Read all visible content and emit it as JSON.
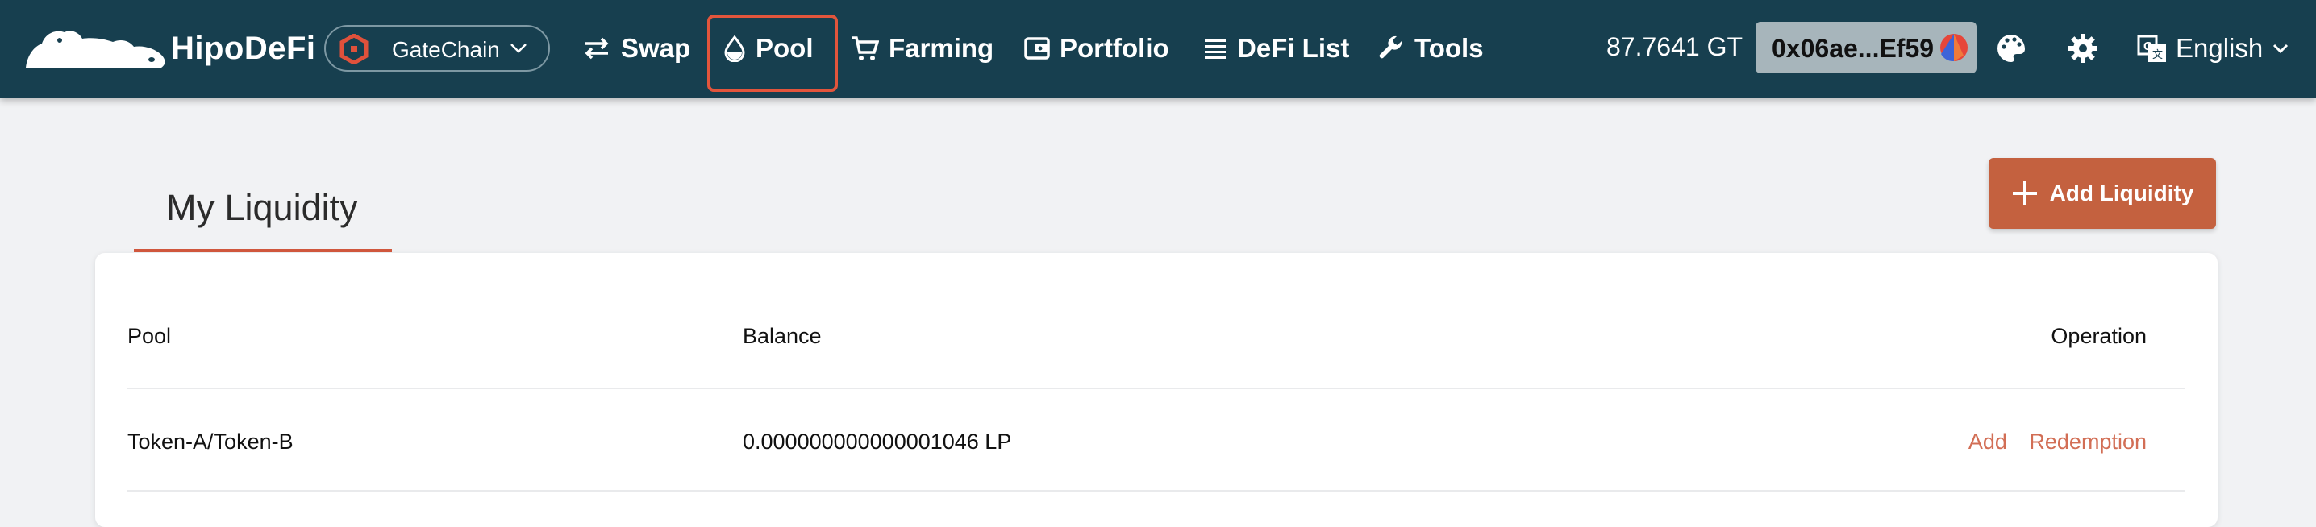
{
  "header": {
    "brand": "HipoDeFi",
    "chain_selector": {
      "label": "GateChain",
      "icon": "gatechain-icon"
    },
    "nav": [
      {
        "label": "Swap",
        "icon": "swap-arrows-icon",
        "active": false
      },
      {
        "label": "Pool",
        "icon": "droplet-icon",
        "active": true
      },
      {
        "label": "Farming",
        "icon": "cart-icon",
        "active": false
      },
      {
        "label": "Portfolio",
        "icon": "wallet-icon",
        "active": false
      },
      {
        "label": "DeFi List",
        "icon": "list-icon",
        "active": false
      },
      {
        "label": "Tools",
        "icon": "wrench-icon",
        "active": false
      }
    ],
    "balance": "87.7641 GT",
    "wallet_address": "0x06ae...Ef59",
    "language": "English",
    "icons": {
      "theme": "palette-icon",
      "settings": "gear-icon",
      "language": "translate-icon"
    }
  },
  "page": {
    "tab_title": "My Liquidity",
    "add_liquidity_label": "Add Liquidity"
  },
  "table": {
    "columns": [
      "Pool",
      "Balance",
      "Operation"
    ],
    "rows": [
      {
        "pool": "Token-A/Token-B",
        "balance": "0.000000000000001046 LP",
        "operations": [
          "Add",
          "Redemption"
        ]
      }
    ]
  },
  "colors": {
    "navbar": "#173f4f",
    "accent": "#c4613f",
    "active_outline": "#e2553c",
    "link": "#d26e55",
    "page_background": "#f1f2f4"
  }
}
